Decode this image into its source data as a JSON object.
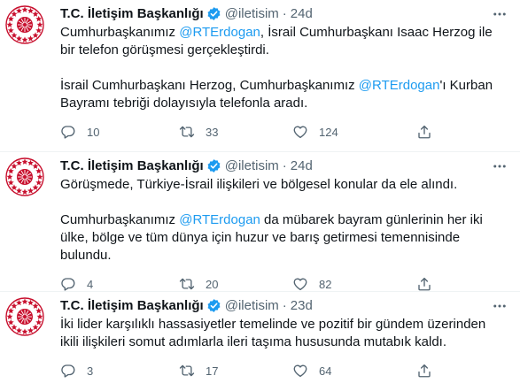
{
  "tweets": [
    {
      "name": "T.C. İletişim Başkanlığı",
      "handle": "@iletisim",
      "dot": "·",
      "time": "24d",
      "paragraphs": [
        [
          "Cumhurbaşkanımız ",
          "@RTErdogan",
          ", İsrail Cumhurbaşkanı Isaac Herzog ile bir telefon görüşmesi gerçekleştirdi."
        ],
        [
          "İsrail Cumhurbaşkanı Herzog, Cumhurbaşkanımız ",
          "@RTErdogan",
          "'ı Kurban Bayramı tebriği dolayısıyla telefonla aradı."
        ]
      ],
      "replies": "10",
      "retweets": "33",
      "likes": "124"
    },
    {
      "name": "T.C. İletişim Başkanlığı",
      "handle": "@iletisim",
      "dot": "·",
      "time": "24d",
      "paragraphs": [
        [
          "Görüşmede, Türkiye-İsrail ilişkileri ve bölgesel konular da ele alındı."
        ],
        [
          "Cumhurbaşkanımız ",
          "@RTErdogan",
          " da mübarek bayram günlerinin her iki ülke, bölge ve tüm dünya için huzur ve barış getirmesi temennisinde bulundu."
        ]
      ],
      "replies": "4",
      "retweets": "20",
      "likes": "82"
    },
    {
      "name": "T.C. İletişim Başkanlığı",
      "handle": "@iletisim",
      "dot": "·",
      "time": "23d",
      "paragraphs": [
        [
          "İki lider karşılıklı hassasiyetler temelinde ve pozitif bir gündem üzerinden ikili ilişkileri somut adımlarla ileri taşıma hususunda mutabık kaldı."
        ]
      ],
      "replies": "3",
      "retweets": "17",
      "likes": "64"
    }
  ],
  "colors": {
    "accent": "#1d9bf0",
    "secondary_text": "#536471",
    "brand_red": "#c8102e"
  },
  "icons": {
    "avatar": "presidency-seal-logo",
    "verified": "verified-badge-icon",
    "more": "more-options-icon",
    "reply": "reply-icon",
    "retweet": "retweet-icon",
    "like": "heart-icon",
    "share": "share-icon"
  }
}
